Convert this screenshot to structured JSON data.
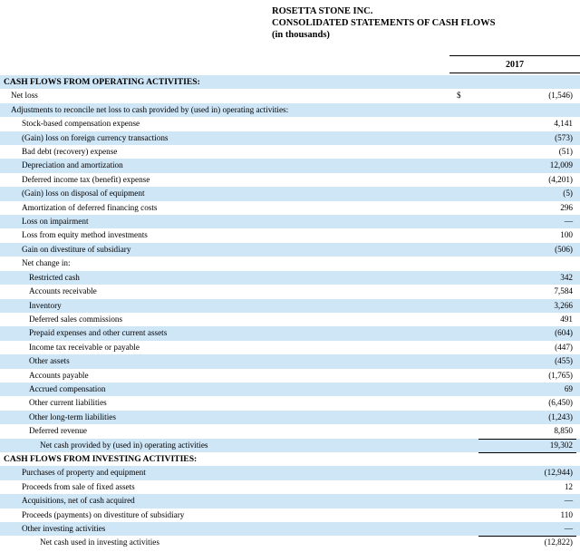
{
  "header": {
    "company": "ROSETTA STONE INC.",
    "statement": "CONSOLIDATED STATEMENTS OF CASH FLOWS",
    "units": "(in thousands)"
  },
  "column": {
    "year": "2017"
  },
  "rows": [
    {
      "label": "CASH FLOWS FROM OPERATING ACTIVITIES:",
      "value": "",
      "currency": ""
    },
    {
      "label": "Net loss",
      "value": "(1,546)",
      "currency": "$"
    },
    {
      "label": "Adjustments to reconcile net loss to cash provided by (used in) operating activities:",
      "value": "",
      "currency": ""
    },
    {
      "label": "Stock-based compensation expense",
      "value": "4,141",
      "currency": ""
    },
    {
      "label": "(Gain) loss on foreign currency transactions",
      "value": "(573)",
      "currency": ""
    },
    {
      "label": "Bad debt (recovery) expense",
      "value": "(51)",
      "currency": ""
    },
    {
      "label": "Depreciation and amortization",
      "value": "12,009",
      "currency": ""
    },
    {
      "label": "Deferred income tax (benefit) expense",
      "value": "(4,201)",
      "currency": ""
    },
    {
      "label": "(Gain) loss on disposal of equipment",
      "value": "(5)",
      "currency": ""
    },
    {
      "label": "Amortization of deferred financing costs",
      "value": "296",
      "currency": ""
    },
    {
      "label": "Loss on impairment",
      "value": "—",
      "currency": ""
    },
    {
      "label": "Loss from equity method investments",
      "value": "100",
      "currency": ""
    },
    {
      "label": "Gain on divestiture of subsidiary",
      "value": "(506)",
      "currency": ""
    },
    {
      "label": "Net change in:",
      "value": "",
      "currency": ""
    },
    {
      "label": "Restricted cash",
      "value": "342",
      "currency": ""
    },
    {
      "label": "Accounts receivable",
      "value": "7,584",
      "currency": ""
    },
    {
      "label": "Inventory",
      "value": "3,266",
      "currency": ""
    },
    {
      "label": "Deferred sales commissions",
      "value": "491",
      "currency": ""
    },
    {
      "label": "Prepaid expenses and other current assets",
      "value": "(604)",
      "currency": ""
    },
    {
      "label": "Income tax receivable or payable",
      "value": "(447)",
      "currency": ""
    },
    {
      "label": "Other assets",
      "value": "(455)",
      "currency": ""
    },
    {
      "label": "Accounts payable",
      "value": "(1,765)",
      "currency": ""
    },
    {
      "label": "Accrued compensation",
      "value": "69",
      "currency": ""
    },
    {
      "label": "Other current liabilities",
      "value": "(6,450)",
      "currency": ""
    },
    {
      "label": "Other long-term liabilities",
      "value": "(1,243)",
      "currency": ""
    },
    {
      "label": "Deferred revenue",
      "value": "8,850",
      "currency": ""
    },
    {
      "label": "Net cash provided by (used in) operating activities",
      "value": "19,302",
      "currency": ""
    },
    {
      "label": "CASH FLOWS FROM INVESTING ACTIVITIES:",
      "value": "",
      "currency": ""
    },
    {
      "label": "Purchases of property and equipment",
      "value": "(12,944)",
      "currency": ""
    },
    {
      "label": "Proceeds from sale of fixed assets",
      "value": "12",
      "currency": ""
    },
    {
      "label": "Acquisitions, net of cash acquired",
      "value": "—",
      "currency": ""
    },
    {
      "label": "Proceeds (payments) on divestiture of subsidiary",
      "value": "110",
      "currency": ""
    },
    {
      "label": "Other investing activities",
      "value": "—",
      "currency": ""
    },
    {
      "label": "Net cash used in investing activities",
      "value": "(12,822)",
      "currency": ""
    }
  ]
}
